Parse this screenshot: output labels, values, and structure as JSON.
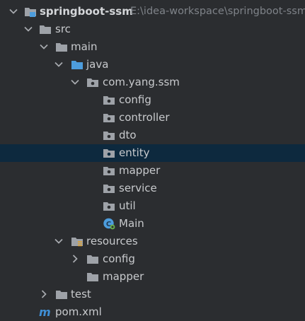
{
  "project": {
    "name": "springboot-ssm",
    "path": "E:\\idea-workspace\\springboot-ssm"
  },
  "tree": [
    {
      "label": "src"
    },
    {
      "label": "main"
    },
    {
      "label": "java"
    },
    {
      "label": "com.yang.ssm"
    },
    {
      "label": "config"
    },
    {
      "label": "controller"
    },
    {
      "label": "dto"
    },
    {
      "label": "entity"
    },
    {
      "label": "mapper"
    },
    {
      "label": "service"
    },
    {
      "label": "util"
    },
    {
      "label": "Main"
    },
    {
      "label": "resources"
    },
    {
      "label": "config"
    },
    {
      "label": "mapper"
    },
    {
      "label": "test"
    },
    {
      "label": "pom.xml"
    }
  ],
  "colors": {
    "background": "#2b2d30",
    "selection": "#0d293e",
    "folder_icon": "#9ea2a8",
    "source_root_icon": "#4d9ddd",
    "resources_badge": "#d9a33b",
    "maven_icon": "#3f8fd6"
  }
}
